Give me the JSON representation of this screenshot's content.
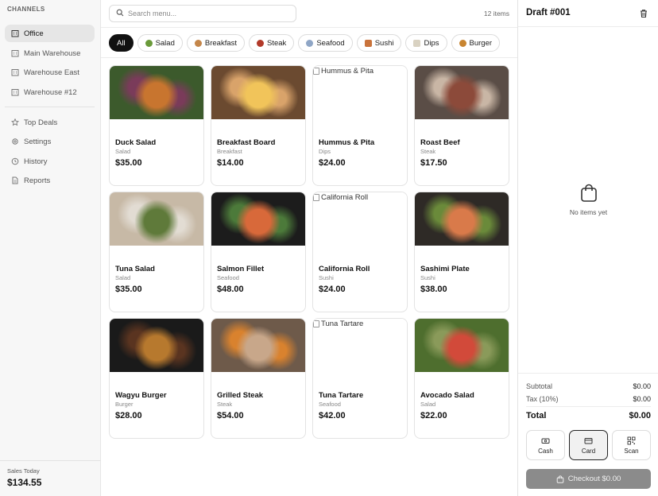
{
  "sidebar": {
    "section_label": "CHANNELS",
    "items": [
      {
        "label": "Office",
        "icon": "building-icon"
      },
      {
        "label": "Main Warehouse",
        "icon": "building-icon"
      },
      {
        "label": "Warehouse East",
        "icon": "building-icon"
      },
      {
        "label": "Warehouse #12",
        "icon": "building-icon"
      },
      {
        "label": "Top Deals",
        "icon": "star-icon"
      },
      {
        "label": "Settings",
        "icon": "gear-icon"
      },
      {
        "label": "History",
        "icon": "history-icon"
      },
      {
        "label": "Reports",
        "icon": "document-icon"
      }
    ],
    "sales_label": "Sales Today",
    "sales_value": "$134.55"
  },
  "search": {
    "placeholder": "Search menu..."
  },
  "item_count": "12 items",
  "chips": [
    {
      "label": "All"
    },
    {
      "label": "Salad",
      "emoji_color": "#6a9a3a"
    },
    {
      "label": "Breakfast",
      "emoji_color": "#c4864a"
    },
    {
      "label": "Steak",
      "emoji_color": "#b23a2a"
    },
    {
      "label": "Seafood",
      "emoji_color": "#8fa6c6"
    },
    {
      "label": "Sushi",
      "emoji_color": "#c9733b"
    },
    {
      "label": "Dips",
      "emoji_color": "#d9d2c2"
    },
    {
      "label": "Burger",
      "emoji_color": "#c88531"
    }
  ],
  "products": [
    {
      "name": "Duck Salad",
      "category": "Salad",
      "price": "$35.00",
      "image": "ok",
      "colors": [
        "#3c5a2c",
        "#c8752f",
        "#7a3b5a"
      ]
    },
    {
      "name": "Breakfast Board",
      "category": "Breakfast",
      "price": "$14.00",
      "image": "ok",
      "colors": [
        "#6b4a30",
        "#f1c45a",
        "#d9a36a"
      ]
    },
    {
      "name": "Hummus & Pita",
      "category": "Dips",
      "price": "$24.00",
      "image": "broken",
      "alt": "Hummus & Pita"
    },
    {
      "name": "Roast Beef",
      "category": "Steak",
      "price": "$17.50",
      "image": "ok",
      "colors": [
        "#5a4d46",
        "#8c4a3a",
        "#c9b6a5"
      ]
    },
    {
      "name": "Tuna Salad",
      "category": "Salad",
      "price": "$35.00",
      "image": "ok",
      "colors": [
        "#c7b9a6",
        "#5f7a3a",
        "#e2dcd3"
      ]
    },
    {
      "name": "Salmon Fillet",
      "category": "Seafood",
      "price": "$48.00",
      "image": "ok",
      "colors": [
        "#1c1c1c",
        "#d8693a",
        "#4c7a3a"
      ]
    },
    {
      "name": "California Roll",
      "category": "Sushi",
      "price": "$24.00",
      "image": "broken",
      "alt": "California Roll"
    },
    {
      "name": "Sashimi Plate",
      "category": "Sushi",
      "price": "$38.00",
      "image": "ok",
      "colors": [
        "#2e2a26",
        "#d97a4a",
        "#6a8a3a"
      ]
    },
    {
      "name": "Wagyu Burger",
      "category": "Burger",
      "price": "$28.00",
      "image": "ok",
      "colors": [
        "#1a1a1a",
        "#b7792e",
        "#5a3420"
      ]
    },
    {
      "name": "Grilled Steak",
      "category": "Steak",
      "price": "$54.00",
      "image": "ok",
      "colors": [
        "#6e5a4a",
        "#c8a78a",
        "#d9822e"
      ]
    },
    {
      "name": "Tuna Tartare",
      "category": "Seafood",
      "price": "$42.00",
      "image": "broken",
      "alt": "Tuna Tartare"
    },
    {
      "name": "Avocado Salad",
      "category": "Salad",
      "price": "$22.00",
      "image": "ok",
      "colors": [
        "#4e6e2e",
        "#d24a3a",
        "#8a9a5a"
      ]
    }
  ],
  "order": {
    "title": "Draft #001",
    "empty_text": "No items yet",
    "subtotal_label": "Subtotal",
    "subtotal_value": "$0.00",
    "tax_label": "Tax (10%)",
    "tax_value": "$0.00",
    "total_label": "Total",
    "total_value": "$0.00",
    "payment_methods": [
      {
        "label": "Cash",
        "icon": "cash-icon"
      },
      {
        "label": "Card",
        "icon": "card-icon",
        "selected": true
      },
      {
        "label": "Scan",
        "icon": "qr-icon"
      }
    ],
    "checkout_label": "Checkout $0.00"
  }
}
